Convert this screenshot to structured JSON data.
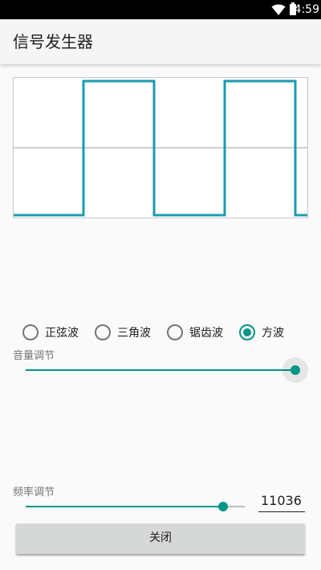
{
  "status_bar": {
    "time": "4:59",
    "icons": [
      "wifi-icon",
      "battery-icon"
    ]
  },
  "app_bar": {
    "title": "信号发生器"
  },
  "waveform_display": {
    "waveform": "square",
    "line_color": "#1a9bb0",
    "midline_color": "#bdbdbd"
  },
  "wave_type": {
    "options": [
      {
        "label": "正弦波",
        "checked": false
      },
      {
        "label": "三角波",
        "checked": false
      },
      {
        "label": "锯齿波",
        "checked": false
      },
      {
        "label": "方波",
        "checked": true
      }
    ]
  },
  "volume": {
    "label": "音量调节",
    "value_fraction": 1.0
  },
  "frequency": {
    "label": "频率调节",
    "value": "11036",
    "slider_fraction": 0.9
  },
  "close_button": {
    "label": "关闭"
  },
  "colors": {
    "accent": "#009688",
    "background": "#fafafa",
    "button": "#d6d7d7"
  }
}
